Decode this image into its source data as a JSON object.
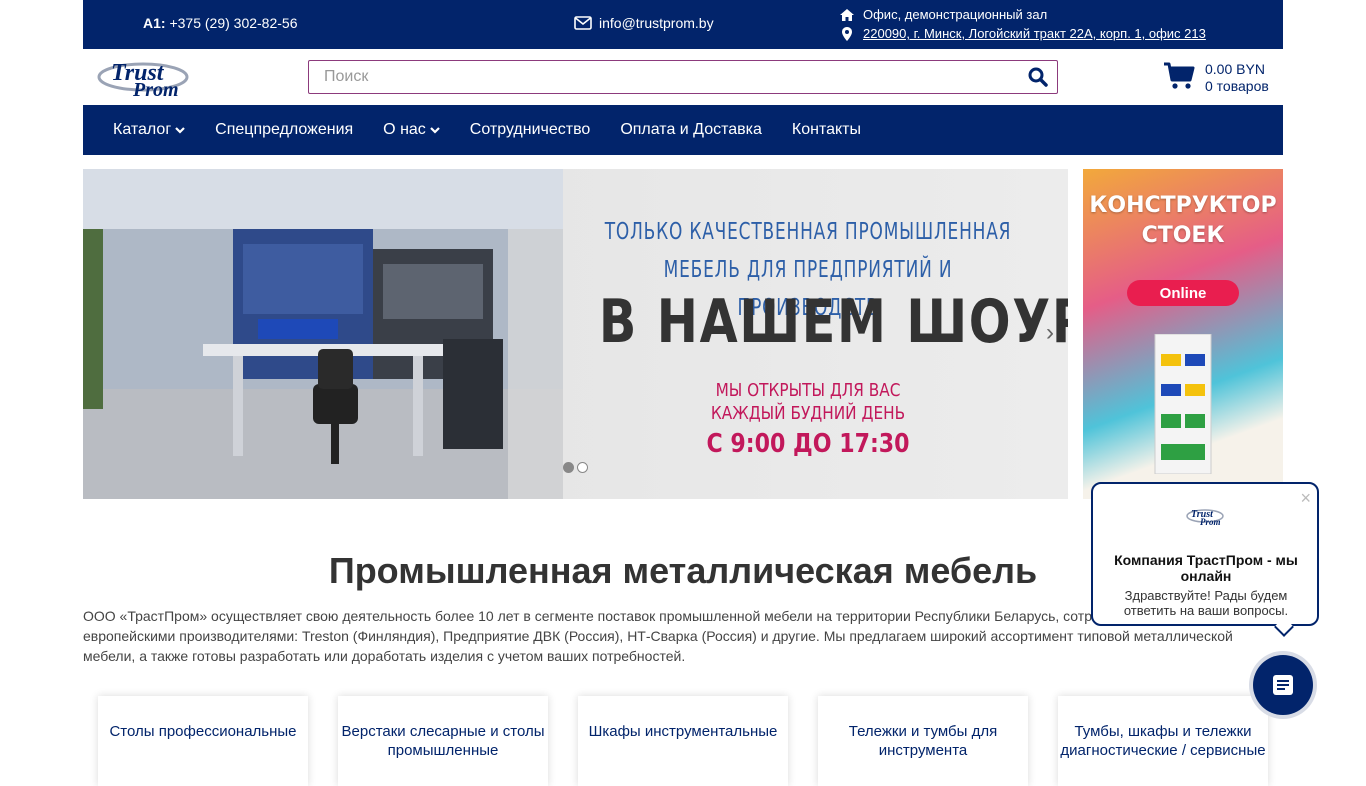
{
  "topbar": {
    "phone_label": "A1:",
    "phone_number": "+375 (29) 302-82-56",
    "email": "info@trustprom.by",
    "office_label": "Офис, демонстрационный зал",
    "office_address": "220090, г. Минск, Логойский тракт 22А, корп. 1, офис 213"
  },
  "header": {
    "logo_alt": "TrustProm",
    "search_placeholder": "Поиск",
    "cart_amount": "0.00 BYN",
    "cart_count": "0 товаров"
  },
  "nav": {
    "items": [
      {
        "label": "Каталог",
        "dropdown": true
      },
      {
        "label": "Спецпредложения",
        "dropdown": false
      },
      {
        "label": "О нас",
        "dropdown": true
      },
      {
        "label": "Сотрудничество",
        "dropdown": false
      },
      {
        "label": "Оплата и Доставка",
        "dropdown": false
      },
      {
        "label": "Контакты",
        "dropdown": false
      }
    ]
  },
  "banner": {
    "line1": "Только качественная промышленная",
    "line1b": "мебель для предприятий и производств",
    "line2": "В НАШЕМ ШОУРУМЕ",
    "line3": "МЫ ОТКРЫТЫ ДЛЯ ВАС",
    "line3b": "КАЖДЫЙ БУДНИЙ ДЕНЬ",
    "line4": "С 9:00 ДО 17:30",
    "next_arrow": "›"
  },
  "ad": {
    "title1": "КОНСТРУКТОР",
    "title2": "СТОЕК",
    "button": "Online"
  },
  "content": {
    "heading": "Промышленная металлическая мебель",
    "description": "ООО «ТрастПром» осуществляет свою деятельность более 10 лет в сегменте поставок промышленной мебели на территории Республики Беларусь, сотр... российскими и европейскими производителями: Treston (Финляндия), Предприятие ДВК (Россия), НТ-Сварка (Россия) и другие. Мы предлагаем широкий ассортимент типовой металлической мебели, а также готовы разработать или доработать изделия с учетом ваших потребностей."
  },
  "categories": [
    "Столы профессиональные",
    "Верстаки слесарные и столы промышленные",
    "Шкафы инструментальные",
    "Тележки и тумбы для инструмента",
    "Тумбы, шкафы и тележки диагностические / сервисные"
  ],
  "chat": {
    "close": "×",
    "title": "Компания ТрастПром - мы онлайн",
    "message": "Здравствуйте! Рады будем ответить на ваши вопросы."
  },
  "colors": {
    "brand_navy": "#02246b",
    "accent_magenta": "#c2185b",
    "search_border": "#8c3a7c"
  }
}
